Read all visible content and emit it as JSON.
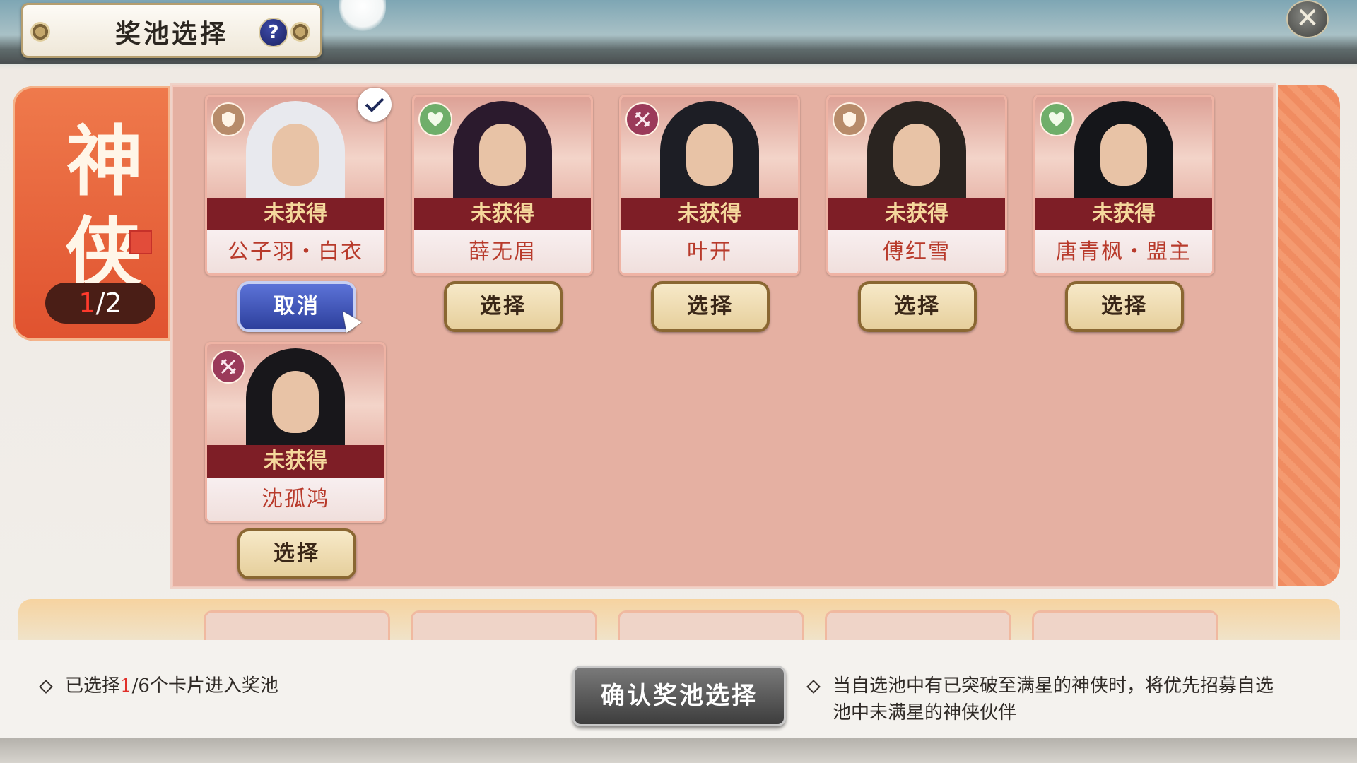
{
  "header": {
    "title": "奖池选择",
    "help_label": "?",
    "close_label": "✕"
  },
  "side_tab": {
    "char1": "神",
    "char2": "侠",
    "count_selected": "1",
    "count_rest": "/2"
  },
  "cards": [
    {
      "status": "未获得",
      "name": "公子羽・白衣",
      "type": "shield-icon",
      "button": "取消",
      "selected": true,
      "hair": "#e8e9ee"
    },
    {
      "status": "未获得",
      "name": "薛无眉",
      "type": "heart-icon",
      "button": "选择",
      "selected": false,
      "hair": "#2b1a2d"
    },
    {
      "status": "未获得",
      "name": "叶开",
      "type": "swords-icon",
      "button": "选择",
      "selected": false,
      "hair": "#1d1e25"
    },
    {
      "status": "未获得",
      "name": "傅红雪",
      "type": "shield-icon",
      "button": "选择",
      "selected": false,
      "hair": "#2a2420"
    },
    {
      "status": "未获得",
      "name": "唐青枫・盟主",
      "type": "heart-icon",
      "button": "选择",
      "selected": false,
      "hair": "#15161a"
    },
    {
      "status": "未获得",
      "name": "沈孤鸿",
      "type": "swords-icon",
      "button": "选择",
      "selected": false,
      "hair": "#18171b"
    }
  ],
  "footer": {
    "selected_prefix": "已选择",
    "selected_count": "1",
    "selected_suffix": "/6个卡片进入奖池",
    "confirm_label": "确认奖池选择",
    "note_line1": "当自选池中有已突破至满星的神侠时，将优先招募自选",
    "note_line2": "池中未满星的神侠伙伴"
  },
  "colors": {
    "panel": "#e5b0a2",
    "status_bar": "#7e1e26",
    "name_text": "#b83a2b",
    "accent_red": "#e0302a"
  }
}
